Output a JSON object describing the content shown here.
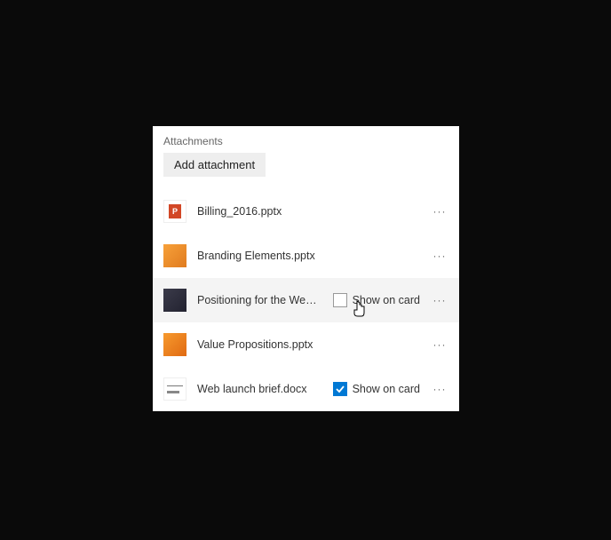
{
  "header": {
    "title": "Attachments",
    "add_label": "Add attachment"
  },
  "show_on_card_label": "Show on card",
  "more_glyph": "···",
  "cursor_row_index": 2,
  "attachments": [
    {
      "filename": "Billing_2016.pptx",
      "thumb": "th-pptx-red",
      "show_checkbox": false,
      "checked": false
    },
    {
      "filename": "Branding Elements.pptx",
      "thumb": "th-orange",
      "show_checkbox": false,
      "checked": false
    },
    {
      "filename": "Positioning for the Web.pptx",
      "thumb": "th-dark",
      "show_checkbox": true,
      "checked": false
    },
    {
      "filename": "Value Propositions.pptx",
      "thumb": "th-orange2",
      "show_checkbox": false,
      "checked": false
    },
    {
      "filename": "Web launch brief.docx",
      "thumb": "th-doc",
      "show_checkbox": true,
      "checked": true
    }
  ]
}
